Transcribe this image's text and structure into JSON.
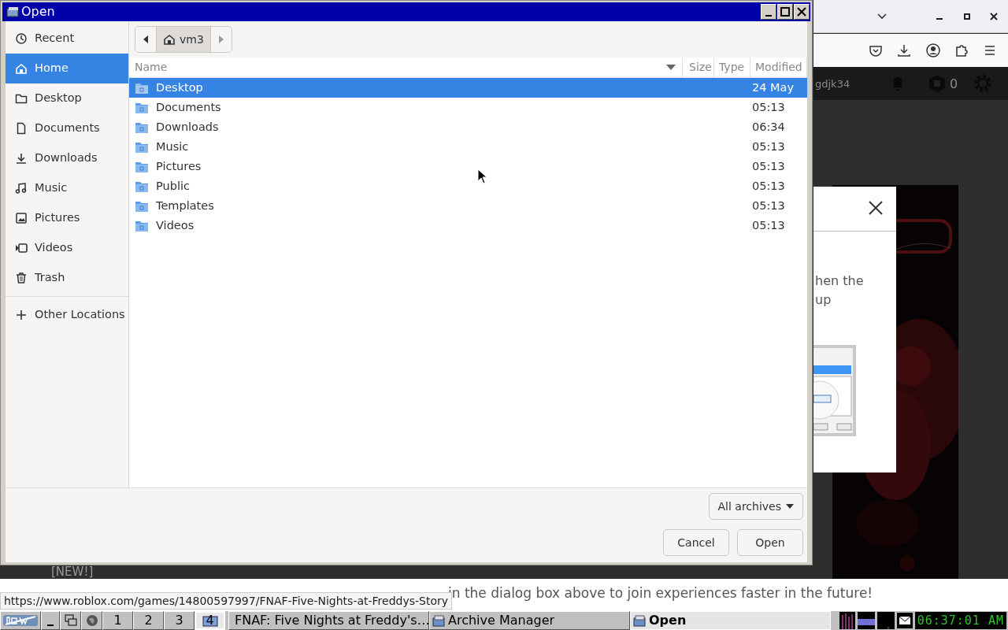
{
  "dialog": {
    "title": "Open",
    "sidebar": [
      {
        "kind": "recent",
        "label": "Recent",
        "selected": false
      },
      {
        "kind": "home",
        "label": "Home",
        "selected": true
      },
      {
        "kind": "folder",
        "label": "Desktop",
        "selected": false
      },
      {
        "kind": "document",
        "label": "Documents",
        "selected": false
      },
      {
        "kind": "download",
        "label": "Downloads",
        "selected": false
      },
      {
        "kind": "music",
        "label": "Music",
        "selected": false
      },
      {
        "kind": "picture",
        "label": "Pictures",
        "selected": false
      },
      {
        "kind": "video",
        "label": "Videos",
        "selected": false
      },
      {
        "kind": "trash",
        "label": "Trash",
        "selected": false
      },
      {
        "kind": "other",
        "label": "Other Locations",
        "selected": false
      }
    ],
    "path": "vm3",
    "columns": [
      "Name",
      "Size",
      "Type",
      "Modified"
    ],
    "rows": [
      {
        "name": "Desktop",
        "modified": "24 May",
        "selected": true
      },
      {
        "name": "Documents",
        "modified": "05:13",
        "selected": false
      },
      {
        "name": "Downloads",
        "modified": "06:34",
        "selected": false
      },
      {
        "name": "Music",
        "modified": "05:13",
        "selected": false
      },
      {
        "name": "Pictures",
        "modified": "05:13",
        "selected": false
      },
      {
        "name": "Public",
        "modified": "05:13",
        "selected": false
      },
      {
        "name": "Templates",
        "modified": "05:13",
        "selected": false
      },
      {
        "name": "Videos",
        "modified": "05:13",
        "selected": false
      }
    ],
    "filter": "All archives",
    "buttons": [
      "Cancel",
      "Open"
    ]
  },
  "page": {
    "username": "gdjk34",
    "robux": "0",
    "modal_lines": [
      "hen the",
      "up"
    ],
    "new_label": "[NEW!]",
    "message": "in the dialog box above to join experiences faster in the future!"
  },
  "status_url": "https://www.roblox.com/games/14800597997/FNAF-Five-Nights-at-Freddys-Story",
  "taskbar": {
    "workspaces": [
      {
        "label": "1",
        "selected": false
      },
      {
        "label": "2",
        "selected": false
      },
      {
        "label": "3",
        "selected": false
      },
      {
        "label": "4",
        "selected": true
      }
    ],
    "tasks": [
      {
        "kind": "browser",
        "label": "FNAF: Five Nights at Freddy's…",
        "selected": false
      },
      {
        "kind": "app",
        "label": "Archive Manager",
        "selected": false
      },
      {
        "kind": "app",
        "label": "Open",
        "selected": true
      }
    ],
    "clock": "06:37:01 AM"
  }
}
